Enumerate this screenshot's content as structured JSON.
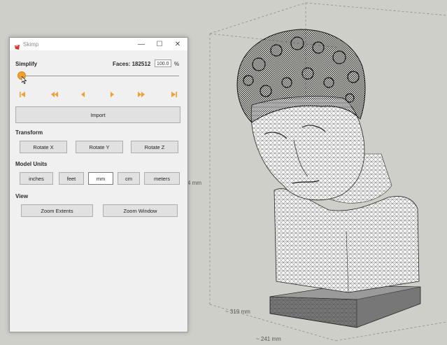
{
  "viewport": {
    "dimension_labels": {
      "height": "4 mm",
      "depth": "~ 319 mm",
      "width": "~ 241 mm"
    }
  },
  "window": {
    "title": "Skimp",
    "controls": {
      "minimize": "—",
      "maximize": "☐",
      "close": "✕"
    }
  },
  "simplify": {
    "label": "Simplify",
    "faces_label": "Faces: 182512",
    "percent_value": "100.0",
    "percent_sign": "%",
    "slider_level": 0.0
  },
  "playback": {
    "icons": [
      "skip-to-start-icon",
      "fast-rewind-icon",
      "step-back-icon",
      "step-forward-icon",
      "fast-forward-icon",
      "skip-to-end-icon"
    ]
  },
  "import_label": "Import",
  "transform": {
    "label": "Transform",
    "buttons": [
      "Rotate X",
      "Rotate Y",
      "Rotate Z"
    ]
  },
  "units": {
    "label": "Model Units",
    "options": [
      "inches",
      "feet",
      "mm",
      "cm",
      "meters"
    ],
    "selected": "mm"
  },
  "view": {
    "label": "View",
    "buttons": [
      "Zoom Extents",
      "Zoom Window"
    ]
  },
  "colors": {
    "accent": "#f0a030",
    "window_bg": "#f0f0f0",
    "viewport_bg": "#cfcfca"
  }
}
